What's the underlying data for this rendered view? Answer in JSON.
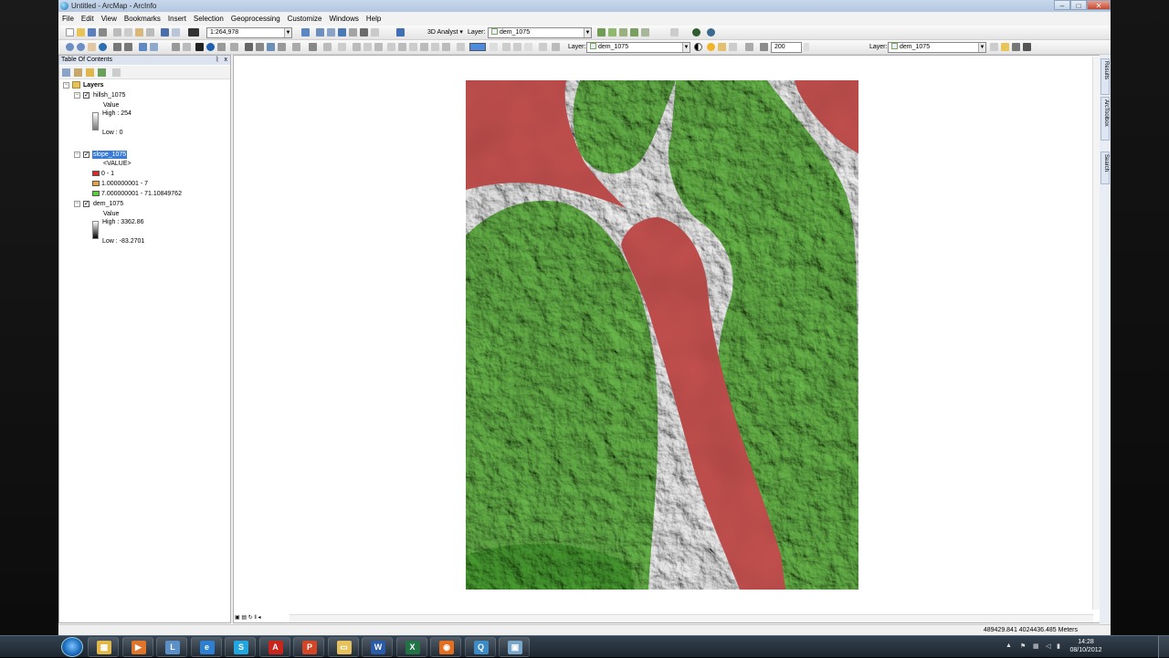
{
  "window": {
    "title": "Untitled - ArcMap - ArcInfo",
    "buttons": {
      "minimize": "–",
      "maximize": "□",
      "close": "✕"
    }
  },
  "menu": [
    "File",
    "Edit",
    "View",
    "Bookmarks",
    "Insert",
    "Selection",
    "Geoprocessing",
    "Customize",
    "Windows",
    "Help"
  ],
  "toolbar1": {
    "scale": "1:264,978",
    "analyst_label": "3D Analyst ▾",
    "layer_label": "Layer:",
    "layer_value": "dem_1075"
  },
  "toolbar2": {
    "layer_label_a": "Layer:",
    "layer_value_a": "dem_1075",
    "zoom_value": "200",
    "layer_label_b": "Layer:",
    "layer_value_b": "dem_1075"
  },
  "toc": {
    "title": "Table Of Contents",
    "pin": "ᚱ",
    "close": "x",
    "root": "Layers",
    "layers": [
      {
        "name": "hillsh_1075",
        "field": "Value",
        "high": "High : 254",
        "low": "Low : 0"
      },
      {
        "name": "slope_1075",
        "field": "<VALUE>",
        "classes": [
          {
            "label": "0 - 1",
            "color": "#d42a2a"
          },
          {
            "label": "1.000000001 - 7",
            "color": "#e6a23c"
          },
          {
            "label": "7.000000001 - 71.10849762",
            "color": "#5ecb3a"
          }
        ]
      },
      {
        "name": "dem_1075",
        "field": "Value",
        "high": "High : 3362.86",
        "low": "Low : -83.2701"
      }
    ]
  },
  "side_tabs": [
    "Results",
    "ArcToolbox",
    "Search"
  ],
  "status": {
    "coords": "489429.841  4024436.485 Meters"
  },
  "map_colors": {
    "low_slope": "#c85250",
    "mid_slope": "#b99066",
    "high_slope": "#6dbf4e"
  },
  "taskbar": {
    "apps": [
      {
        "name": "explorer",
        "glyph": "▦",
        "color": "#e0b94a"
      },
      {
        "name": "media",
        "glyph": "▶",
        "color": "#e0752a"
      },
      {
        "name": "arccatalog",
        "glyph": "L",
        "color": "#5a8fc7"
      },
      {
        "name": "ie",
        "glyph": "e",
        "color": "#2c7fd1"
      },
      {
        "name": "skype",
        "glyph": "S",
        "color": "#23a6e0"
      },
      {
        "name": "acrobat",
        "glyph": "A",
        "color": "#c8261c"
      },
      {
        "name": "powerpoint",
        "glyph": "P",
        "color": "#d24626"
      },
      {
        "name": "folder",
        "glyph": "▭",
        "color": "#e7c15b"
      },
      {
        "name": "word",
        "glyph": "W",
        "color": "#2a5ba8"
      },
      {
        "name": "excel",
        "glyph": "X",
        "color": "#217346"
      },
      {
        "name": "firefox",
        "glyph": "◉",
        "color": "#e56d1e"
      },
      {
        "name": "arcmap",
        "glyph": "Q",
        "color": "#3b8bc6"
      },
      {
        "name": "remote",
        "glyph": "▣",
        "color": "#7aa6c9"
      }
    ],
    "time": "14:28",
    "date": "08/10/2012"
  }
}
